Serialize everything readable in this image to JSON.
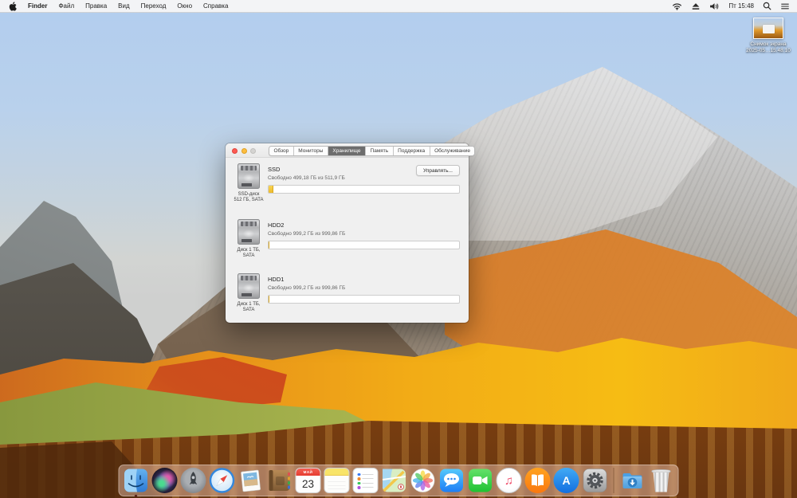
{
  "menu_bar": {
    "apple_icon": "apple-logo",
    "items": [
      "Finder",
      "Файл",
      "Правка",
      "Вид",
      "Переход",
      "Окно",
      "Справка"
    ],
    "status": {
      "icons": [
        "wifi",
        "eject",
        "volume",
        "spotlight",
        "notification-center"
      ],
      "time": "Пт 15:48"
    }
  },
  "desktop_icon": {
    "line1": "Снимок экрана",
    "line2": "2025-05…15.48.10"
  },
  "window": {
    "tabs": [
      {
        "label": "Обзор",
        "selected": false
      },
      {
        "label": "Мониторы",
        "selected": false
      },
      {
        "label": "Хранилище",
        "selected": true
      },
      {
        "label": "Память",
        "selected": false
      },
      {
        "label": "Поддержка",
        "selected": false
      },
      {
        "label": "Обслуживание",
        "selected": false
      }
    ],
    "drives": [
      {
        "name": "SSD",
        "free": "Свободно 499,18 ГБ из 511,9 ГБ",
        "disk_label1": "SSD-диск",
        "disk_label2": "512 ГБ, SATA",
        "used_percent": 2.5,
        "manage_label": "Управлять..."
      },
      {
        "name": "HDD2",
        "free": "Свободно 999,2 ГБ из 999,86 ГБ",
        "disk_label1": "Диск 1 ТБ,",
        "disk_label2": "SATA",
        "used_percent": 0.1
      },
      {
        "name": "HDD1",
        "free": "Свободно 999,2 ГБ из 999,86 ГБ",
        "disk_label1": "Диск 1 ТБ,",
        "disk_label2": "SATA",
        "used_percent": 0.1
      }
    ]
  },
  "dock": {
    "apps": [
      "finder",
      "siri",
      "launchpad",
      "safari",
      "preview",
      "contacts",
      "calendar",
      "notes",
      "reminders",
      "maps",
      "photos",
      "messages",
      "facetime",
      "itunes",
      "ibooks",
      "app-store",
      "system-preferences",
      "downloads",
      "trash"
    ],
    "calendar": {
      "month": "МАЙ",
      "day": "23"
    },
    "running": [
      "finder"
    ]
  },
  "colors": {
    "storage_bar_used": "#efc23a",
    "tab_selected_bg": "#6d6d6d",
    "close_button": "#fd5a52",
    "minimize_button": "#fdbe40"
  }
}
